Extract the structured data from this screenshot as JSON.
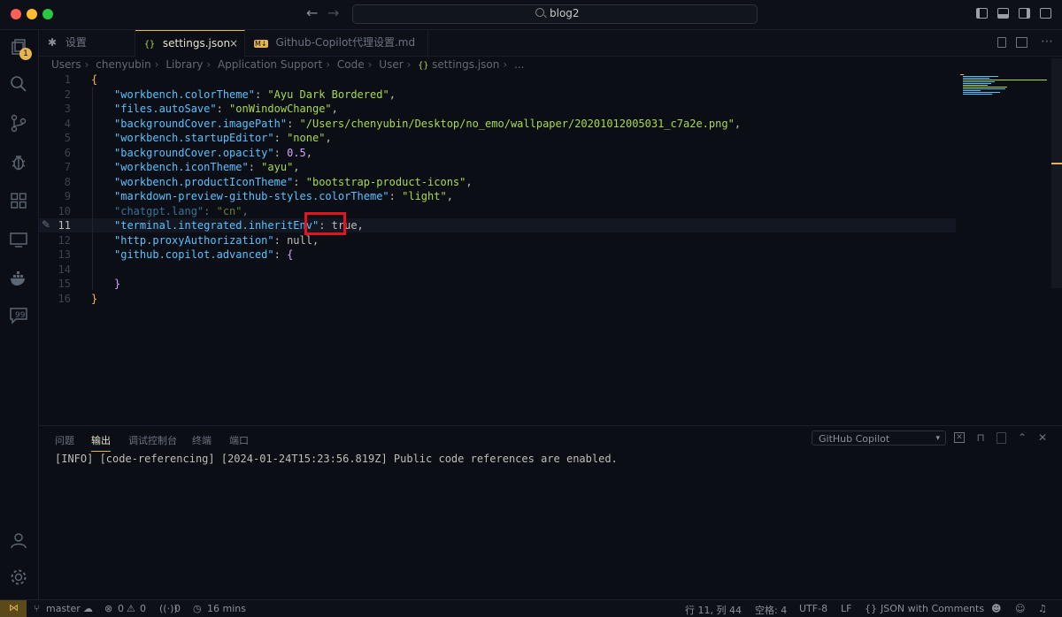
{
  "titlebar": {
    "search_text": "blog2",
    "back": "←",
    "forward": "→"
  },
  "activitybar": {
    "badge": "1"
  },
  "tabs": [
    {
      "icon": "✱",
      "label": "设置"
    },
    {
      "icon": "{}",
      "label": "settings.json",
      "close": "×"
    },
    {
      "icon": "M↓",
      "label": "Github-Copilot代理设置.md"
    }
  ],
  "breadcrumb": [
    "Users",
    "chenyubin",
    "Library",
    "Application Support",
    "Code",
    "User",
    "settings.json",
    "..."
  ],
  "editor": {
    "lines": [
      {
        "n": "1",
        "key": "",
        "val": "",
        "open": "{"
      },
      {
        "n": "2",
        "key": "\"workbench.colorTheme\"",
        "val": "\"Ayu Dark Bordered\"",
        "type": "s"
      },
      {
        "n": "3",
        "key": "\"files.autoSave\"",
        "val": "\"onWindowChange\"",
        "type": "s"
      },
      {
        "n": "4",
        "key": "\"backgroundCover.imagePath\"",
        "val": "\"/Users/chenyubin/Desktop/no_emo/wallpaper/20201012005031_c7a2e.png\"",
        "type": "s"
      },
      {
        "n": "5",
        "key": "\"workbench.startupEditor\"",
        "val": "\"none\"",
        "type": "s"
      },
      {
        "n": "6",
        "key": "\"backgroundCover.opacity\"",
        "val": "0.5",
        "type": "n"
      },
      {
        "n": "7",
        "key": "\"workbench.iconTheme\"",
        "val": "\"ayu\"",
        "type": "s"
      },
      {
        "n": "8",
        "key": "\"workbench.productIconTheme\"",
        "val": "\"bootstrap-product-icons\"",
        "type": "s"
      },
      {
        "n": "9",
        "key": "\"markdown-preview-github-styles.colorTheme\"",
        "val": "\"light\"",
        "type": "s"
      },
      {
        "n": "10",
        "key": "\"chatgpt.lang\"",
        "val": "\"cn\"",
        "type": "s"
      },
      {
        "n": "11",
        "key": "\"terminal.integrated.inheritEnv\"",
        "val": "true",
        "type": "p"
      },
      {
        "n": "12",
        "key": "\"http.proxyAuthorization\"",
        "val": "null",
        "type": "p"
      },
      {
        "n": "13",
        "key": "\"github.copilot.advanced\"",
        "val": "{",
        "type": "b"
      },
      {
        "n": "14",
        "key": "",
        "val": ""
      },
      {
        "n": "15",
        "key": "",
        "val": "",
        "close2": "}"
      },
      {
        "n": "16",
        "key": "",
        "val": "",
        "close": "}"
      }
    ]
  },
  "panel": {
    "tabs": [
      "问题",
      "输出",
      "调试控制台",
      "终端",
      "端口"
    ],
    "channel": "GitHub Copilot",
    "log": "[INFO] [code-referencing] [2024-01-24T15:23:56.819Z] Public code references are enabled."
  },
  "statusbar": {
    "branch": "master",
    "errors": "0",
    "warnings": "0",
    "ports": "0",
    "time": "16 mins",
    "position": "行 11, 列 44",
    "spaces": "空格: 4",
    "encoding": "UTF-8",
    "eol": "LF",
    "language": "JSON with Comments"
  },
  "colors": {
    "accent": "#e6b450",
    "highlight": "#e4131c",
    "bg": "#0b0e14"
  }
}
